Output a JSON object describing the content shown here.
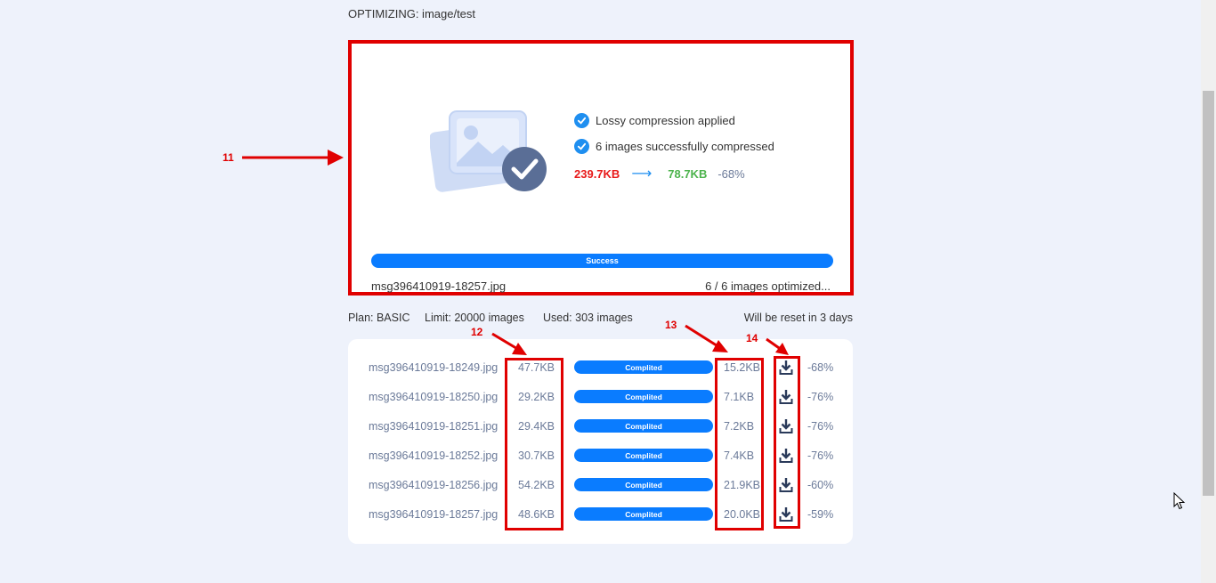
{
  "header": {
    "title": "OPTIMIZING: image/test"
  },
  "summary": {
    "items": [
      "Lossy compression applied",
      "6 images successfully compressed"
    ],
    "size_before": "239.7KB",
    "size_after": "78.7KB",
    "reduction": "-68%",
    "progress_label": "Success",
    "progress_fraction": 1.0,
    "current_file": "msg396410919-18257.jpg",
    "count_text": "6 / 6 images optimized..."
  },
  "plan": {
    "plan": "Plan: BASIC",
    "limit": "Limit: 20000 images",
    "used": "Used: 303 images",
    "reset": "Will be reset in 3 days"
  },
  "files": [
    {
      "name": "msg396410919-18249.jpg",
      "original": "47.7KB",
      "status": "Complited",
      "optimized": "15.2KB",
      "reduction": "-68%"
    },
    {
      "name": "msg396410919-18250.jpg",
      "original": "29.2KB",
      "status": "Complited",
      "optimized": "7.1KB",
      "reduction": "-76%"
    },
    {
      "name": "msg396410919-18251.jpg",
      "original": "29.4KB",
      "status": "Complited",
      "optimized": "7.2KB",
      "reduction": "-76%"
    },
    {
      "name": "msg396410919-18252.jpg",
      "original": "30.7KB",
      "status": "Complited",
      "optimized": "7.4KB",
      "reduction": "-76%"
    },
    {
      "name": "msg396410919-18256.jpg",
      "original": "54.2KB",
      "status": "Complited",
      "optimized": "21.9KB",
      "reduction": "-60%"
    },
    {
      "name": "msg396410919-18257.jpg",
      "original": "48.6KB",
      "status": "Complited",
      "optimized": "20.0KB",
      "reduction": "-59%"
    }
  ],
  "annotations": [
    "11",
    "12",
    "13",
    "14"
  ],
  "icons": {
    "check": "check-circle-icon",
    "arrow": "right-arrow-icon",
    "download": "download-icon",
    "illustration": "image-check-icon"
  },
  "colors": {
    "accent": "#0a7cff",
    "before": "#e81a1a",
    "after": "#4cb34c",
    "highlight": "#e00000"
  }
}
